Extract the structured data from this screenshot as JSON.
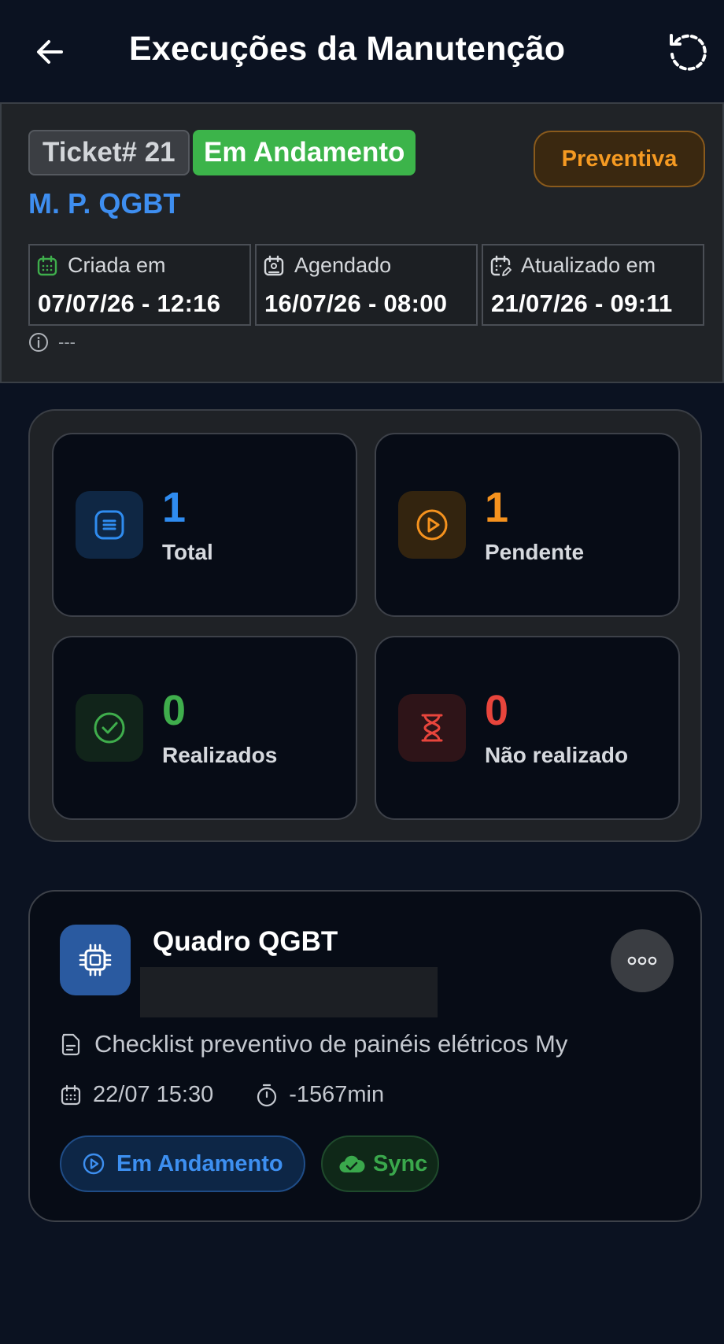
{
  "header": {
    "title": "Execuções da Manutenção",
    "back_icon": "arrow-left-icon",
    "refresh_icon": "refresh-icon"
  },
  "ticket": {
    "number_label": "Ticket# 21",
    "status": "Em Andamento",
    "type": "Preventiva",
    "name": "M. P. QGBT",
    "dates": [
      {
        "label": "Criada em",
        "value": "07/07/26 - 12:16",
        "icon": "calendar-icon"
      },
      {
        "label": "Agendado",
        "value": "16/07/26 - 08:00",
        "icon": "calendar-user-icon"
      },
      {
        "label": "Atualizado em",
        "value": "21/07/26 - 09:11",
        "icon": "calendar-edit-icon"
      }
    ],
    "note": "---"
  },
  "summary": {
    "total": {
      "value": "1",
      "label": "Total",
      "color": "#2f8cf0"
    },
    "pendente": {
      "value": "1",
      "label": "Pendente",
      "color": "#f5921e"
    },
    "realizados": {
      "value": "0",
      "label": "Realizados",
      "color": "#3fae4c"
    },
    "nao_realizado": {
      "value": "0",
      "label": "Não realizado",
      "color": "#e8453c"
    }
  },
  "execution": {
    "equipment": "Quadro QGBT",
    "checklist": "Checklist preventivo de painéis elétricos My",
    "date": "22/07 15:30",
    "duration": "-1567min",
    "status": "Em Andamento",
    "sync": "Sync"
  },
  "colors": {
    "background": "#0b1221",
    "accent_blue": "#3e8ef0",
    "status_green": "#3cb44a",
    "preventiva_orange": "#f59a22"
  }
}
